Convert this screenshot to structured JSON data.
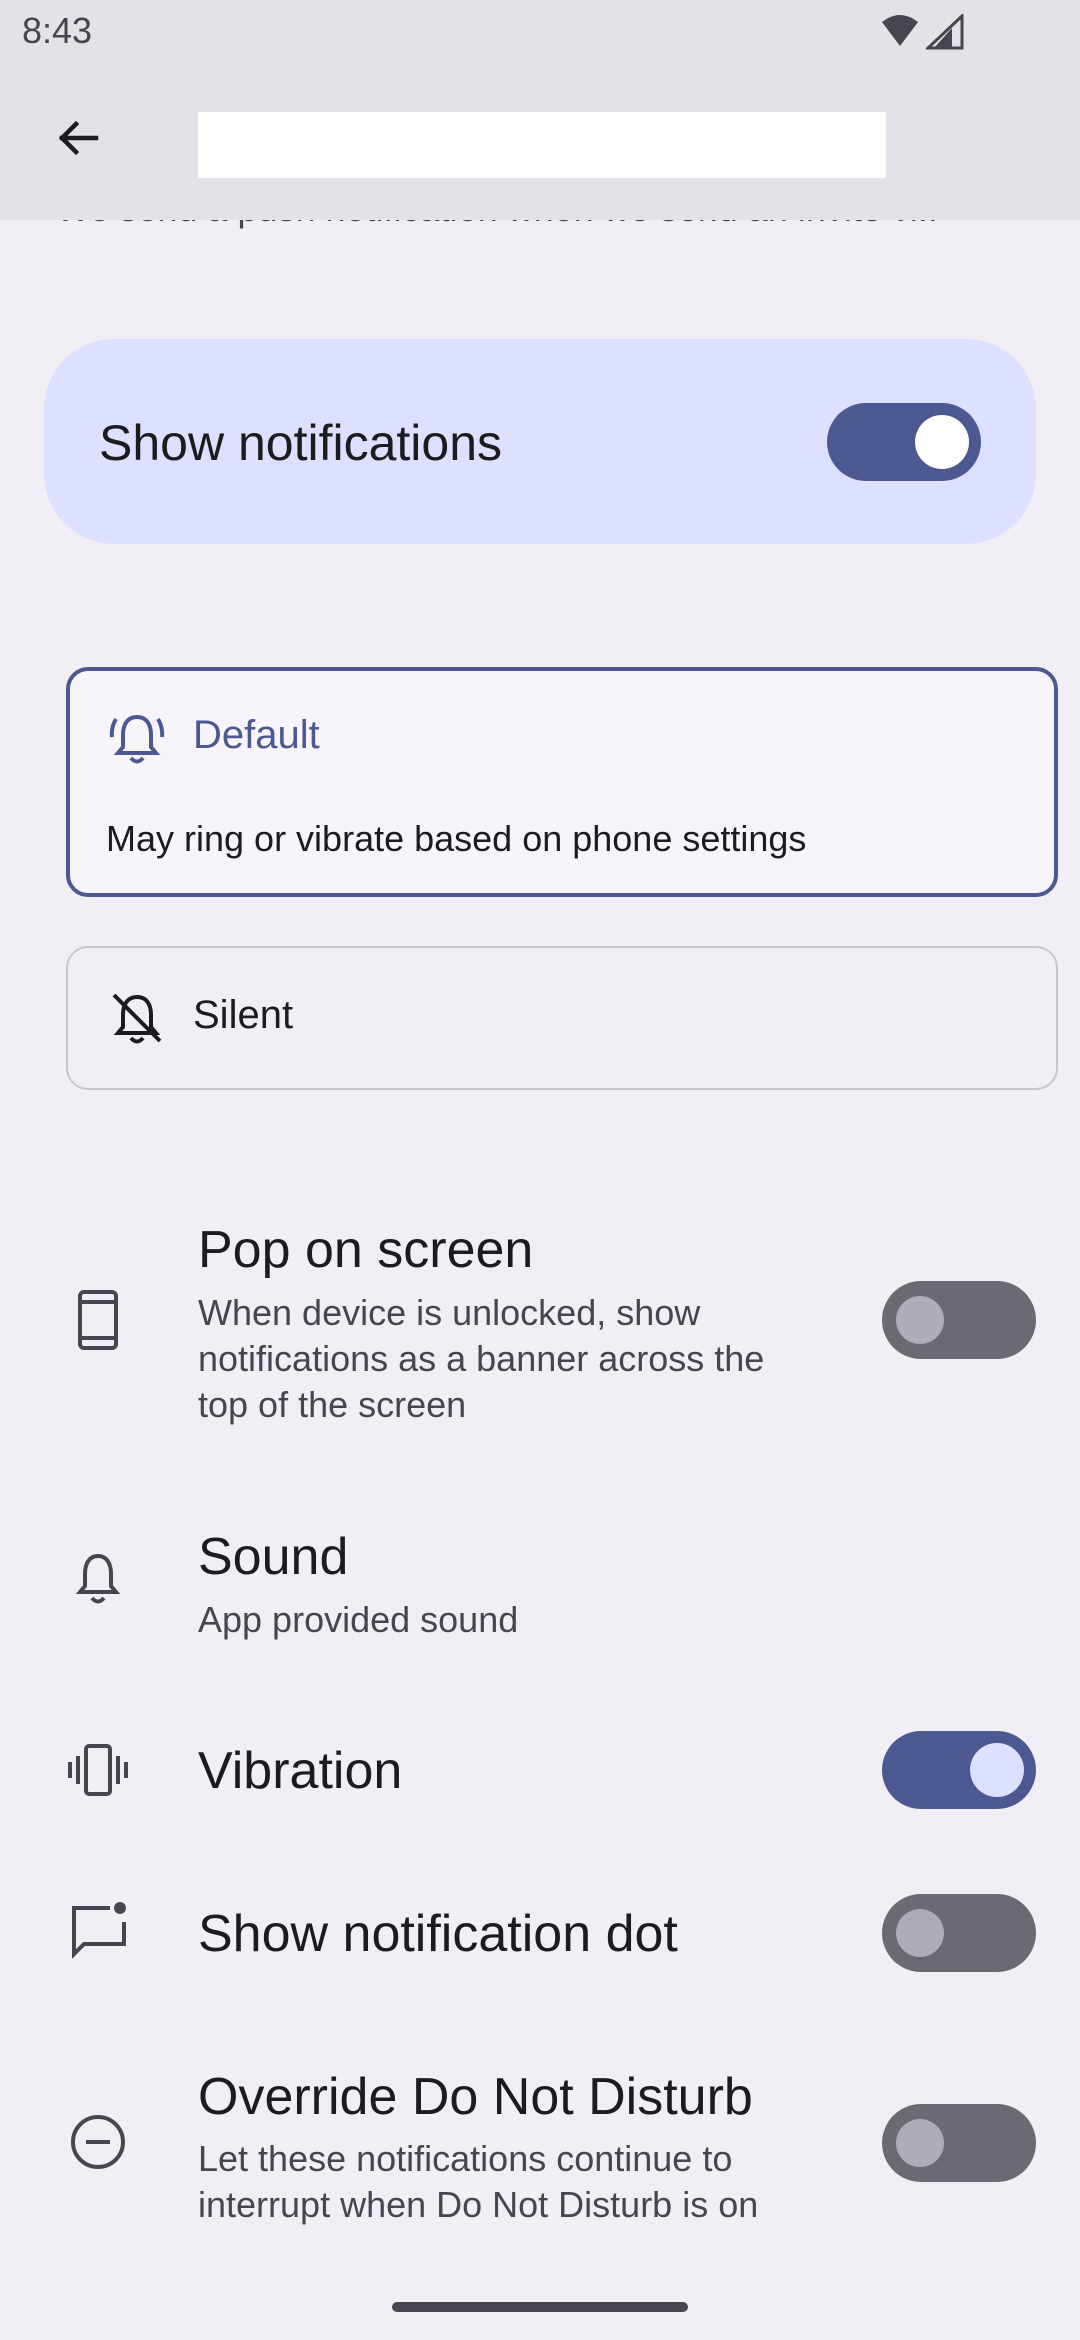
{
  "status_bar": {
    "time": "8:43",
    "icons": [
      "wifi-icon",
      "cell-signal-icon"
    ]
  },
  "app_bar": {
    "back_icon": "arrow-back-icon",
    "title": ""
  },
  "description": "We send a push notification when we send an invite vi..",
  "show_notifications": {
    "label": "Show notifications",
    "enabled": true
  },
  "behavior": {
    "default": {
      "icon": "ringing-bell-icon",
      "title": "Default",
      "desc": "May ring or vibrate based on phone settings",
      "selected": true
    },
    "silent": {
      "icon": "bell-off-icon",
      "title": "Silent",
      "selected": false
    }
  },
  "pop_on_screen": {
    "icon": "phone-icon",
    "title": "Pop on screen",
    "desc_lines": [
      "When device is unlocked, show",
      "notifications as a banner across the",
      "top of the screen"
    ],
    "enabled": false
  },
  "sound": {
    "icon": "bell-icon",
    "title": "Sound",
    "desc": "App provided sound"
  },
  "vibration": {
    "icon": "vibration-icon",
    "title": "Vibration",
    "enabled": true
  },
  "notification_dot": {
    "icon": "message-dot-icon",
    "title": "Show notification dot",
    "enabled": false
  },
  "override_dnd": {
    "icon": "do-not-disturb-icon",
    "title": "Override Do Not Disturb",
    "desc_lines": [
      "Let these notifications continue to",
      "interrupt when Do Not Disturb is on"
    ],
    "enabled": false
  },
  "colors": {
    "accent": "#4c5891",
    "accent_container": "#dee0ff",
    "background": "#f1eff5",
    "switch_off": "#6a6a72"
  }
}
